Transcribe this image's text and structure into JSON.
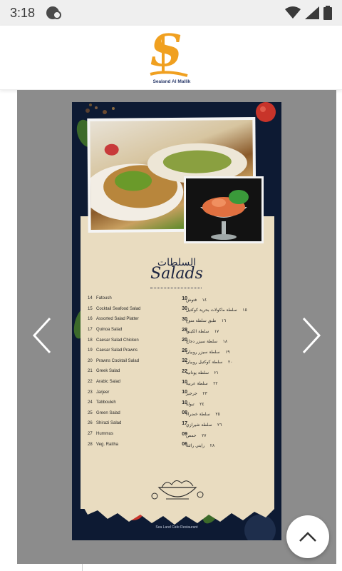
{
  "status_bar": {
    "time": "3:18"
  },
  "header": {
    "logo_text": "S",
    "logo_caption": "Sealand Al Mallik"
  },
  "gallery": {
    "poster": {
      "title_ar": "السلطات",
      "title_en": "Salads",
      "items_en": [
        {
          "num": "14",
          "name": "Fatoush",
          "price": "10"
        },
        {
          "num": "15",
          "name": "Cocktail Seafood Salad",
          "price": "30"
        },
        {
          "num": "16",
          "name": "Assorted Salad Platter",
          "price": "30"
        },
        {
          "num": "17",
          "name": "Quinoa Salad",
          "price": "28"
        },
        {
          "num": "18",
          "name": "Caesar Salad Chicken",
          "price": "20"
        },
        {
          "num": "19",
          "name": "Caesar Salad Prawns",
          "price": "26"
        },
        {
          "num": "20",
          "name": "Prawns Cocktail Salad",
          "price": "32"
        },
        {
          "num": "21",
          "name": "Greek Salad",
          "price": "22"
        },
        {
          "num": "22",
          "name": "Arabic Salad",
          "price": "10"
        },
        {
          "num": "23",
          "name": "Jarjeer",
          "price": "10"
        },
        {
          "num": "24",
          "name": "Tabbouleh",
          "price": "10"
        },
        {
          "num": "25",
          "name": "Green Salad",
          "price": "08"
        },
        {
          "num": "26",
          "name": "Shirazi Salad",
          "price": "17"
        },
        {
          "num": "27",
          "name": "Hummus",
          "price": "09"
        },
        {
          "num": "28",
          "name": "Veg. Raitha",
          "price": "06"
        }
      ],
      "items_ar": [
        {
          "num": "١٤",
          "name": "فتوش"
        },
        {
          "num": "١٥",
          "name": "سلطة ماكولات بحرية كوكتيل"
        },
        {
          "num": "١٦",
          "name": "طبق سلطة منوع"
        },
        {
          "num": "١٧",
          "name": "سلطة الكينوا"
        },
        {
          "num": "١٨",
          "name": "سلطة سيزر دجاج"
        },
        {
          "num": "١٩",
          "name": "سلطة سيزر روبيان"
        },
        {
          "num": "٢٠",
          "name": "سلطة كوكتيل روبيان"
        },
        {
          "num": "٢١",
          "name": "سلطة يونانية"
        },
        {
          "num": "٢٢",
          "name": "سلطة عربية"
        },
        {
          "num": "٢٣",
          "name": "جرجير"
        },
        {
          "num": "٢٤",
          "name": "تبولة"
        },
        {
          "num": "٢٥",
          "name": "سلطة خضراء"
        },
        {
          "num": "٢٦",
          "name": "سلطة شيرازي"
        },
        {
          "num": "٢٧",
          "name": "حمص"
        },
        {
          "num": "٢٨",
          "name": "رايتي رائتة"
        }
      ],
      "footer_credit": "Sea Land Cafe Restaurant"
    }
  },
  "colors": {
    "accent": "#f0a020",
    "poster_bg": "#0d1a33",
    "paper": "#e9dcc0"
  },
  "icons": {
    "prev": "chevron-left-icon",
    "next": "chevron-right-icon",
    "scroll_top": "chevron-up-icon"
  }
}
